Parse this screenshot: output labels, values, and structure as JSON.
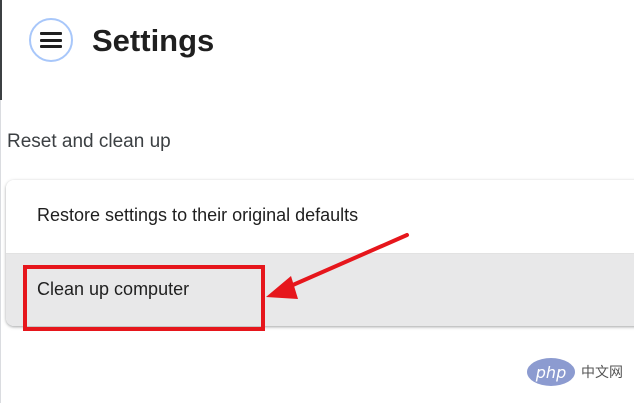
{
  "header": {
    "title": "Settings",
    "menu_icon": "hamburger-menu-icon"
  },
  "section": {
    "heading": "Reset and clean up",
    "items": [
      {
        "label": "Restore settings to their original defaults",
        "highlighted": false
      },
      {
        "label": "Clean up computer",
        "highlighted": true
      }
    ]
  },
  "annotation": {
    "box_color": "#e6161c",
    "arrow_color": "#e6161c"
  },
  "watermark": {
    "logo": "php",
    "site": "中文网"
  }
}
